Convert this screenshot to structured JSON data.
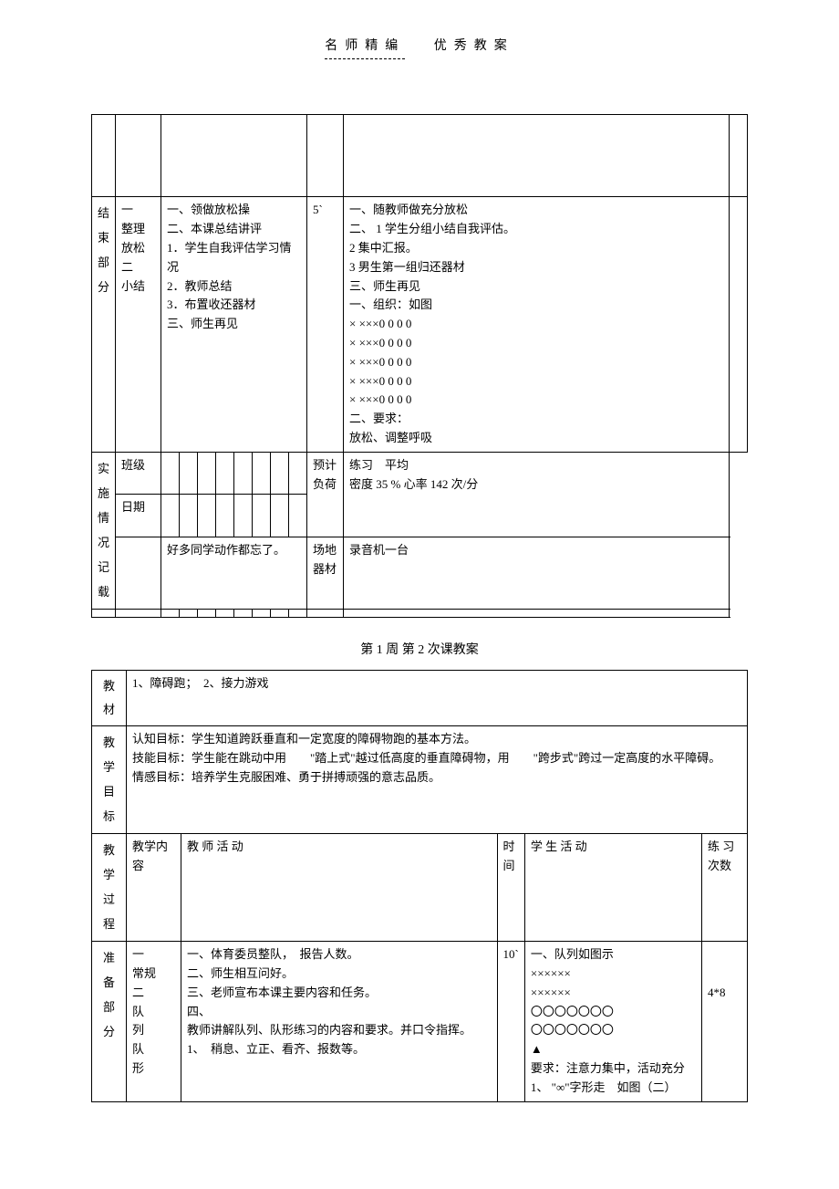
{
  "header": {
    "left": "名师精编",
    "right": "优秀教案"
  },
  "table1": {
    "section_label": "结束部分",
    "col2": "一\n整理\n放松\n二\n小结",
    "col3": "一、领做放松操\n二、本课总结讲评\n1．学生自我评估学习情况\n2．教师总结\n3．布置收还器材\n三、师生再见",
    "col4": "5`",
    "col5": "一、随教师做充分放松\n二、 1 学生分组小结自我评估。\n2 集中汇报。\n3 男生第一组归还器材\n三、师生再见\n一、组织：如图\n× ×××0 0 0 0\n× ×××0 0 0 0\n× ×××0 0 0 0\n× ×××0 0 0 0\n× ×××0 0 0 0\n二、要求：\n放松、调整呼吸",
    "impl_label": "实施情况记载",
    "row_class_label": "班级",
    "row_date_label": "日期",
    "forecast_label": "预计负荷",
    "forecast_value": "练习　平均\n密度 35 %  心率 142 次/分",
    "note": "好多同学动作都忘了。",
    "venue_label": "场地器材",
    "venue_value": "录音机一台"
  },
  "section_title": "第 1 周 第 2 次课教案",
  "table2": {
    "row_material_label": "教材",
    "row_material_value": "1、障碍跑；　2、接力游戏",
    "row_goal_label": "教学目标",
    "row_goal_value": "认知目标：学生知道跨跃垂直和一定宽度的障碍物跑的基本方法。\n技能目标：学生能在跳动中用　　\"踏上式\"越过低高度的垂直障碍物，用　　\"跨步式\"跨过一定高度的水平障碍。\n情感目标：培养学生克服困难、勇于拼搏顽强的意志品质。",
    "h1": "教学过程",
    "h2": "教学内容",
    "h3": "教 师 活 动",
    "h4": "时间",
    "h5": "学 生 活 动",
    "h6": "练 习 次数",
    "prep_label": "准备部分",
    "prep_col2": "一\n常规\n二\n队\n列\n队\n形",
    "prep_col3": "一、体育委员整队，　报告人数。\n二、师生相互问好。\n三、老师宣布本课主要内容和任务。\n四、\n教师讲解队列、队形练习的内容和要求。并口令指挥。\n1、　稍息、立正、看齐、报数等。",
    "prep_col4": "10`",
    "prep_col5": "一、队列如图示\n××××××\n××××××\n〇〇〇〇〇〇〇\n〇〇〇〇〇〇〇\n▲\n要求：注意力集中，活动充分\n1、 \"∞\"字形走　如图（二）",
    "prep_col6": "4*8"
  }
}
